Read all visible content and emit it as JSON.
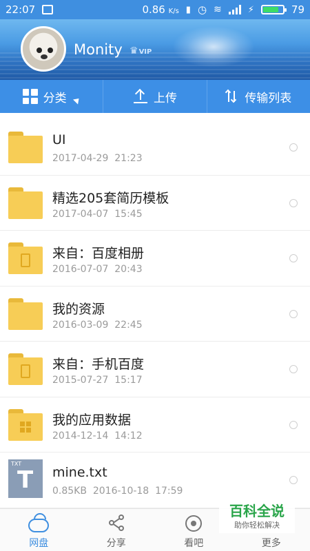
{
  "status_bar": {
    "time": "22:07",
    "speed": "0.86",
    "speed_unit": "K/s",
    "battery": "79"
  },
  "profile": {
    "username": "Monity",
    "vip_label": "VIP"
  },
  "toolbar": {
    "category_label": "分类",
    "upload_label": "上传",
    "transfer_label": "传输列表"
  },
  "files": [
    {
      "name": "UI",
      "meta": "2017-04-29  21:23",
      "icon": "folder-icon"
    },
    {
      "name": "精选205套简历模板",
      "meta": "2017-04-07  15:45",
      "icon": "folder-icon"
    },
    {
      "name": "来自：百度相册",
      "meta": "2016-07-07  20:43",
      "icon": "phone-folder-icon"
    },
    {
      "name": "我的资源",
      "meta": "2016-03-09  22:45",
      "icon": "folder-icon"
    },
    {
      "name": "来自：手机百度",
      "meta": "2015-07-27  15:17",
      "icon": "phone-folder-icon"
    },
    {
      "name": "我的应用数据",
      "meta": "2014-12-14  14:12",
      "icon": "apps-folder-icon"
    },
    {
      "name": "mine.txt",
      "meta": "0.85KB  2016-10-18  17:59",
      "icon": "txt-file-icon",
      "file_badge": "TXT",
      "file_letter": "T"
    }
  ],
  "bottom_nav": {
    "items": [
      {
        "label": "网盘",
        "icon": "cloud-icon",
        "active": true
      },
      {
        "label": "分享",
        "icon": "share-icon",
        "active": false
      },
      {
        "label": "看吧",
        "icon": "eye-icon",
        "active": false
      },
      {
        "label": "更多",
        "icon": "more-icon",
        "active": false
      }
    ]
  },
  "watermark": {
    "title": "百科全说",
    "subtitle": "助你轻松解决"
  },
  "colors": {
    "accent": "#3f8fe0",
    "folder": "#f7cd56",
    "watermark_green": "#2aa54a"
  }
}
